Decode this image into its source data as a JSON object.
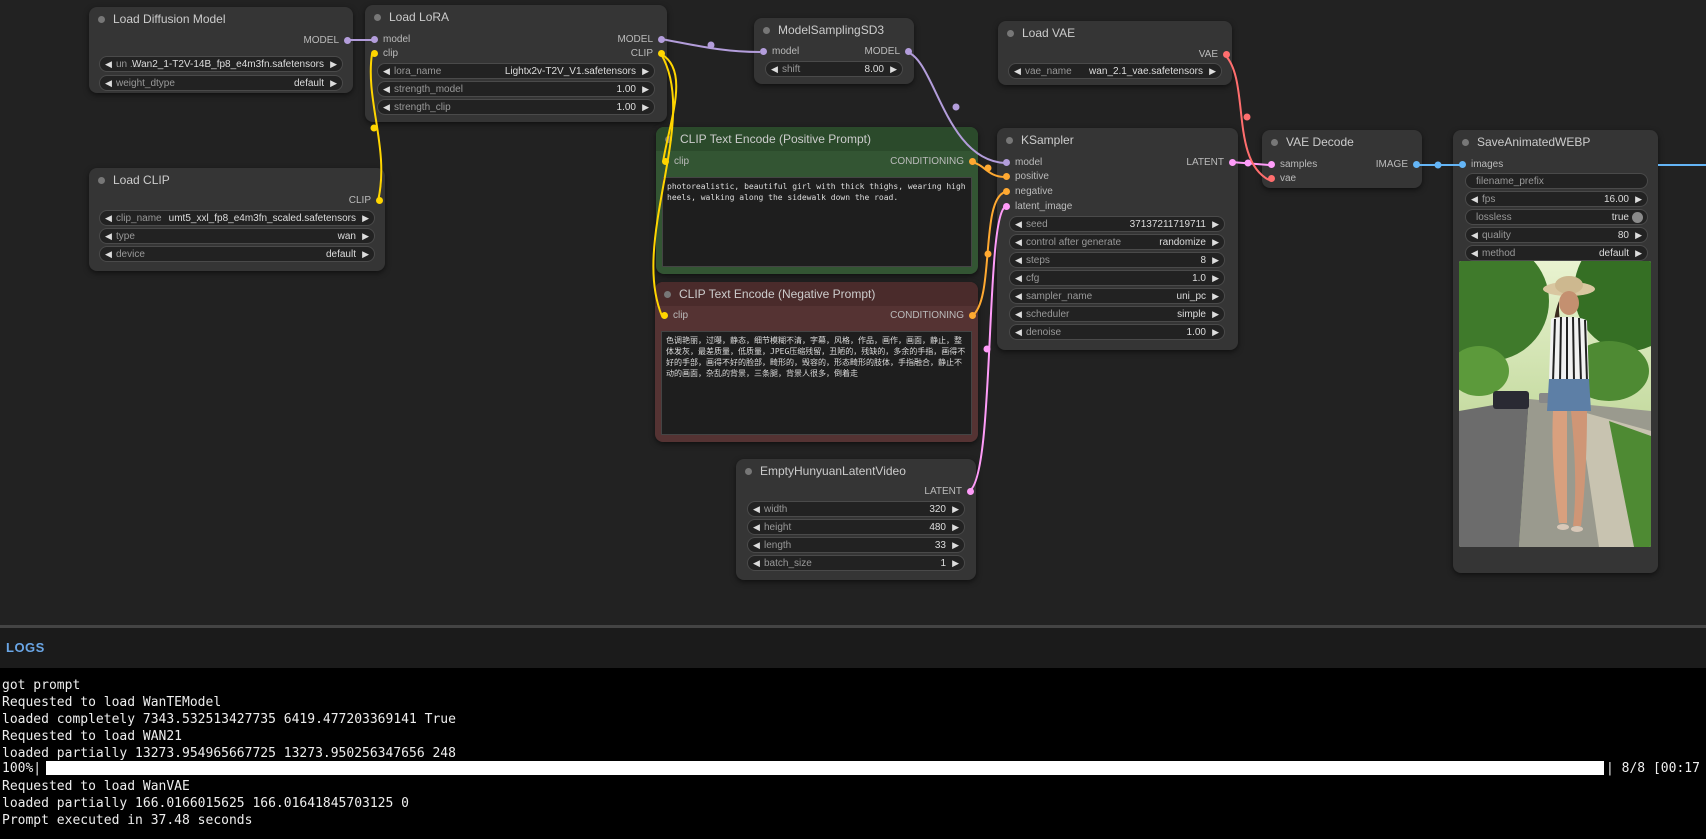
{
  "nodes": {
    "load_diffusion": {
      "title": "Load Diffusion Model",
      "output": "MODEL",
      "widgets": [
        {
          "label": "un ...",
          "value": "Wan2_1-T2V-14B_fp8_e4m3fn.safetensors"
        },
        {
          "label": "weight_dtype",
          "value": "default"
        }
      ]
    },
    "load_lora": {
      "title": "Load LoRA",
      "inputs": [
        "model",
        "clip"
      ],
      "outputs": [
        "MODEL",
        "CLIP"
      ],
      "widgets": [
        {
          "label": "lora_name",
          "value": "Lightx2v-T2V_V1.safetensors"
        },
        {
          "label": "strength_model",
          "value": "1.00"
        },
        {
          "label": "strength_clip",
          "value": "1.00"
        }
      ]
    },
    "model_sampling": {
      "title": "ModelSamplingSD3",
      "input": "model",
      "output": "MODEL",
      "widgets": [
        {
          "label": "shift",
          "value": "8.00"
        }
      ]
    },
    "load_vae": {
      "title": "Load VAE",
      "output": "VAE",
      "widgets": [
        {
          "label": "vae_name",
          "value": "wan_2.1_vae.safetensors"
        }
      ]
    },
    "load_clip": {
      "title": "Load CLIP",
      "output": "CLIP",
      "widgets": [
        {
          "label": "clip_name",
          "value": "umt5_xxl_fp8_e4m3fn_scaled.safetensors"
        },
        {
          "label": "type",
          "value": "wan"
        },
        {
          "label": "device",
          "value": "default"
        }
      ]
    },
    "clip_pos": {
      "title": "CLIP Text Encode (Positive Prompt)",
      "input": "clip",
      "output": "CONDITIONING",
      "text": "photorealistic, beautiful girl with thick thighs, wearing high heels, walking along the sidewalk down the road."
    },
    "clip_neg": {
      "title": "CLIP Text Encode (Negative Prompt)",
      "input": "clip",
      "output": "CONDITIONING",
      "text": "色调艳丽，过曝，静态，细节模糊不清，字幕，风格，作品，画作，画面，静止，整体发灰，最差质量，低质量，JPEG压缩残留，丑陋的，残缺的，多余的手指，画得不好的手部，画得不好的脸部，畸形的，毁容的，形态畸形的肢体，手指融合，静止不动的画面，杂乱的背景，三条腿，背景人很多，倒着走"
    },
    "empty_latent": {
      "title": "EmptyHunyuanLatentVideo",
      "output": "LATENT",
      "widgets": [
        {
          "label": "width",
          "value": "320"
        },
        {
          "label": "height",
          "value": "480"
        },
        {
          "label": "length",
          "value": "33"
        },
        {
          "label": "batch_size",
          "value": "1"
        }
      ]
    },
    "ksampler": {
      "title": "KSampler",
      "inputs": [
        "model",
        "positive",
        "negative",
        "latent_image"
      ],
      "output": "LATENT",
      "widgets": [
        {
          "label": "seed",
          "value": "37137211719711"
        },
        {
          "label": "control after generate",
          "value": "randomize"
        },
        {
          "label": "steps",
          "value": "8"
        },
        {
          "label": "cfg",
          "value": "1.0"
        },
        {
          "label": "sampler_name",
          "value": "uni_pc"
        },
        {
          "label": "scheduler",
          "value": "simple"
        },
        {
          "label": "denoise",
          "value": "1.00"
        }
      ]
    },
    "vae_decode": {
      "title": "VAE Decode",
      "inputs": [
        "samples",
        "vae"
      ],
      "output": "IMAGE"
    },
    "save_webp": {
      "title": "SaveAnimatedWEBP",
      "input": "images",
      "filename_prefix": "filename_prefix",
      "widgets": [
        {
          "label": "fps",
          "value": "16.00"
        },
        {
          "label": "lossless",
          "value": "true"
        },
        {
          "label": "quality",
          "value": "80"
        },
        {
          "label": "method",
          "value": "default"
        }
      ]
    }
  },
  "logs": {
    "title": "LOGS",
    "lines": [
      "got prompt",
      "Requested to load WanTEModel",
      "loaded completely 7343.532513427735 6419.477203369141 True",
      "Requested to load WAN21",
      "loaded partially 13273.954965667725 13273.950256347656 248"
    ],
    "progress_label": "100%|",
    "progress_percent": 100,
    "progress_suffix": "| 8/8 [00:17",
    "lines_after": [
      "Requested to load WanVAE",
      "loaded partially 166.0166015625 166.01641845703125 0",
      "Prompt executed in 37.48 seconds"
    ]
  },
  "colors": {
    "model": "#b39ddb",
    "clip": "#ffd500",
    "conditioning": "#ffa931",
    "latent": "#ff9cf9",
    "vae": "#ff6e6e",
    "image": "#64b5f6"
  }
}
